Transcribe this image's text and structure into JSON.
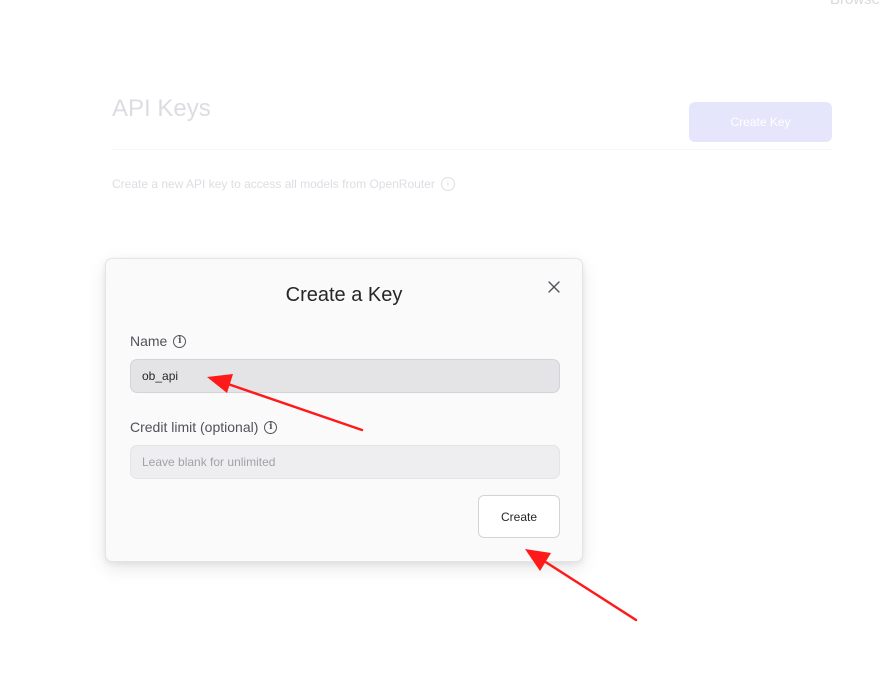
{
  "topnav": {
    "browse_label": "Browse"
  },
  "page": {
    "title": "API Keys",
    "create_button_label": "Create Key",
    "subtitle": "Create a new API key to access all models from OpenRouter"
  },
  "modal": {
    "title": "Create a Key",
    "name_label": "Name",
    "name_value": "ob_api",
    "credit_label": "Credit limit (optional)",
    "credit_placeholder": "Leave blank for unlimited",
    "submit_label": "Create"
  },
  "colors": {
    "annotation_arrow": "#ff1a1a",
    "create_key_button": "#e5e6fb"
  }
}
